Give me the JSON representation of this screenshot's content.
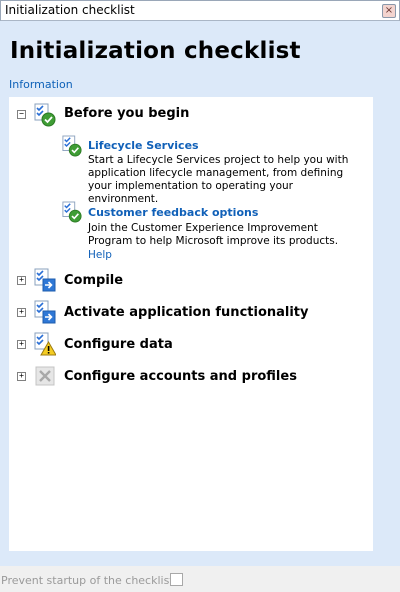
{
  "window": {
    "title": "Initialization checklist",
    "close_glyph": "×"
  },
  "page": {
    "title": "Initialization checklist",
    "info_link": "Information"
  },
  "groups": [
    {
      "label": "Before you begin",
      "expander": "−",
      "icon": "checklist-complete-icon",
      "items": [
        {
          "title": "Lifecycle Services",
          "description": "Start a Lifecycle Services project to help you with application lifecycle management, from defining your implementation to operating your environment.",
          "icon": "checklist-complete-icon"
        },
        {
          "title": "Customer feedback options",
          "description": "Join the Customer Experience Improvement Program to help Microsoft improve its products.",
          "link": "Help",
          "icon": "checklist-complete-icon"
        }
      ]
    },
    {
      "label": "Compile",
      "expander": "+",
      "icon": "checklist-next-icon"
    },
    {
      "label": "Activate application functionality",
      "expander": "+",
      "icon": "checklist-next-icon"
    },
    {
      "label": "Configure data",
      "expander": "+",
      "icon": "checklist-warning-icon"
    },
    {
      "label": "Configure accounts and profiles",
      "expander": "+",
      "icon": "disabled-x-icon"
    }
  ],
  "footer": {
    "label": "Prevent startup of the checklist:",
    "checked": false
  }
}
